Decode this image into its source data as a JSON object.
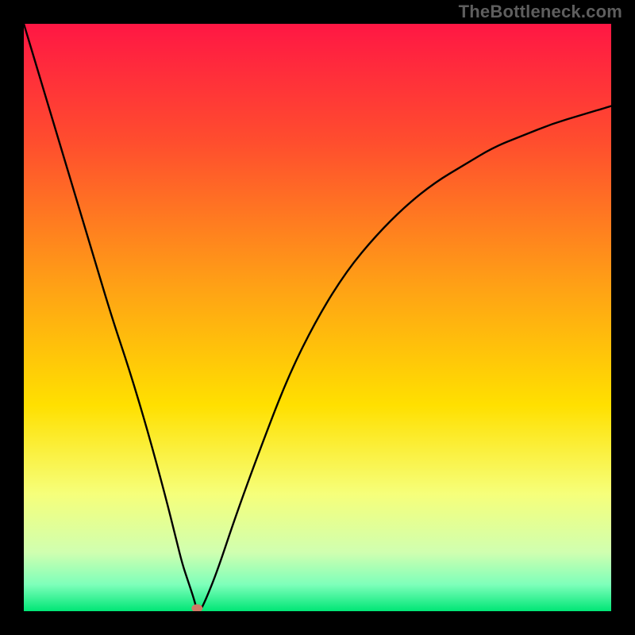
{
  "watermark": "TheBottleneck.com",
  "chart_data": {
    "type": "line",
    "title": "",
    "xlabel": "",
    "ylabel": "",
    "xlim": [
      0,
      100
    ],
    "ylim": [
      0,
      100
    ],
    "grid": false,
    "legend": false,
    "background_gradient": {
      "stops": [
        {
          "pos": 0.0,
          "color": "#ff1744"
        },
        {
          "pos": 0.2,
          "color": "#ff4d2e"
        },
        {
          "pos": 0.45,
          "color": "#ffa215"
        },
        {
          "pos": 0.65,
          "color": "#ffe000"
        },
        {
          "pos": 0.8,
          "color": "#f6ff7a"
        },
        {
          "pos": 0.9,
          "color": "#d0ffb0"
        },
        {
          "pos": 0.955,
          "color": "#7dffba"
        },
        {
          "pos": 1.0,
          "color": "#00e676"
        }
      ]
    },
    "marker": {
      "x": 29.5,
      "y": 0.5,
      "color": "#cf7a66"
    },
    "series": [
      {
        "name": "bottleneck-curve",
        "x": [
          0,
          3,
          6,
          9,
          12,
          15,
          18,
          21,
          24,
          26,
          27,
          28,
          29,
          29.5,
          30,
          31,
          33,
          36,
          40,
          45,
          50,
          55,
          60,
          65,
          70,
          75,
          80,
          85,
          90,
          95,
          100
        ],
        "y": [
          100,
          90,
          80,
          70,
          60,
          50,
          41,
          31,
          20,
          12,
          8,
          5,
          2,
          0,
          0,
          2,
          7,
          16,
          27,
          40,
          50,
          58,
          64,
          69,
          73,
          76,
          79,
          81,
          83,
          84.5,
          86
        ]
      }
    ]
  }
}
